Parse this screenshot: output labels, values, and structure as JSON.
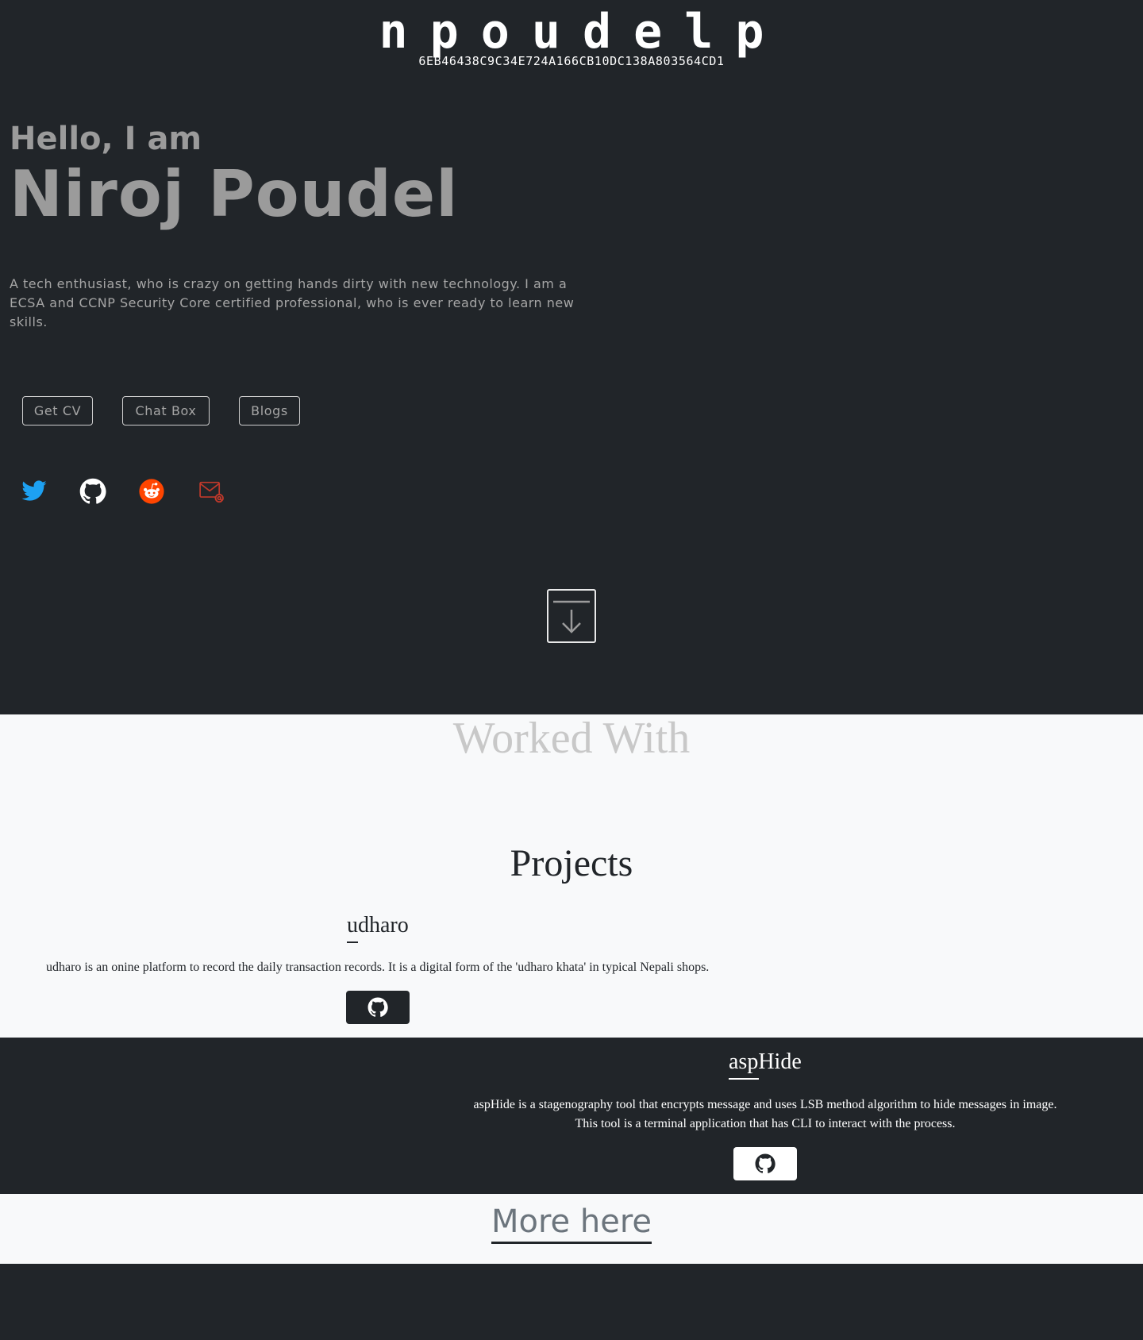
{
  "header": {
    "logo": "npoudelp",
    "hash": "6EB46438C9C34E724A166CB10DC138A803564CD1"
  },
  "intro": {
    "greeting": "Hello, I am",
    "name": "Niroj Poudel",
    "bio": "A tech enthusiast, who is crazy on getting hands dirty with new technology. I am a ECSA and CCNP Security Core certified professional, who is ever ready to learn new skills."
  },
  "buttons": {
    "cv": "Get CV",
    "chat": "Chat Box",
    "blogs": "Blogs"
  },
  "social": {
    "twitter_color": "#1DA1F2",
    "github_color": "#ffffff",
    "reddit_color": "#FF4500",
    "email_color": "#C0392B"
  },
  "sections": {
    "worked_with": "Worked With",
    "projects": "Projects",
    "more": "More here"
  },
  "projects": [
    {
      "title": "udharo",
      "description": "udharo is an onine platform to record the daily transaction records. It is a digital form of the 'udharo khata' in typical Nepali shops."
    },
    {
      "title": "aspHide",
      "description": "aspHide is a stagenography tool that encrypts message and uses LSB method algorithm to hide messages in image. This tool is a terminal application that has CLI to interact with the process."
    }
  ]
}
